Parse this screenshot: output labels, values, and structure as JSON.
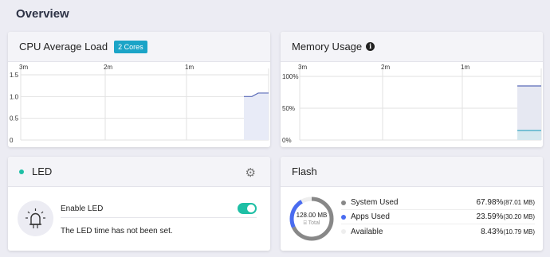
{
  "page": {
    "title": "Overview"
  },
  "cpu": {
    "title": "CPU Average Load",
    "badge": "2 Cores",
    "x_ticks": [
      "3m",
      "2m",
      "1m"
    ],
    "y_ticks": [
      "1.5",
      "1.0",
      "0.5",
      "0"
    ],
    "chart_data": {
      "type": "area",
      "x_labels": [
        "3m",
        "2m",
        "1m"
      ],
      "y_ticks": [
        0,
        0.5,
        1.0,
        1.5
      ],
      "ylim": [
        0,
        1.5
      ],
      "series": [
        {
          "values": [
            1.0,
            1.0,
            1.08,
            1.08
          ]
        }
      ]
    }
  },
  "memory": {
    "title": "Memory Usage",
    "x_ticks": [
      "3m",
      "2m",
      "1m"
    ],
    "y_ticks": [
      "100%",
      "50%",
      "0%"
    ],
    "chart_data": {
      "type": "area",
      "x_labels": [
        "3m",
        "2m",
        "1m"
      ],
      "y_ticks": [
        0,
        50,
        100
      ],
      "ylim": [
        0,
        100
      ],
      "series": [
        {
          "values": [
            85,
            85
          ]
        },
        {
          "values": [
            15,
            15
          ]
        }
      ]
    }
  },
  "led": {
    "title": "LED",
    "enable_label": "Enable LED",
    "enabled": true,
    "message": "The LED time has not been set."
  },
  "flash": {
    "title": "Flash",
    "total_value": "128.00 MB",
    "total_label": "Total",
    "items": [
      {
        "label": "System Used",
        "percent": "67.98%",
        "size": "(87.01 MB)",
        "color": "#888888",
        "fraction": 0.6798
      },
      {
        "label": "Apps Used",
        "percent": "23.59%",
        "size": "(30.20 MB)",
        "color": "#4a6cf0",
        "fraction": 0.2359
      },
      {
        "label": "Available",
        "percent": "8.43%",
        "size": "(10.79 MB)",
        "color": "#eeeeee",
        "fraction": 0.0843
      }
    ]
  }
}
